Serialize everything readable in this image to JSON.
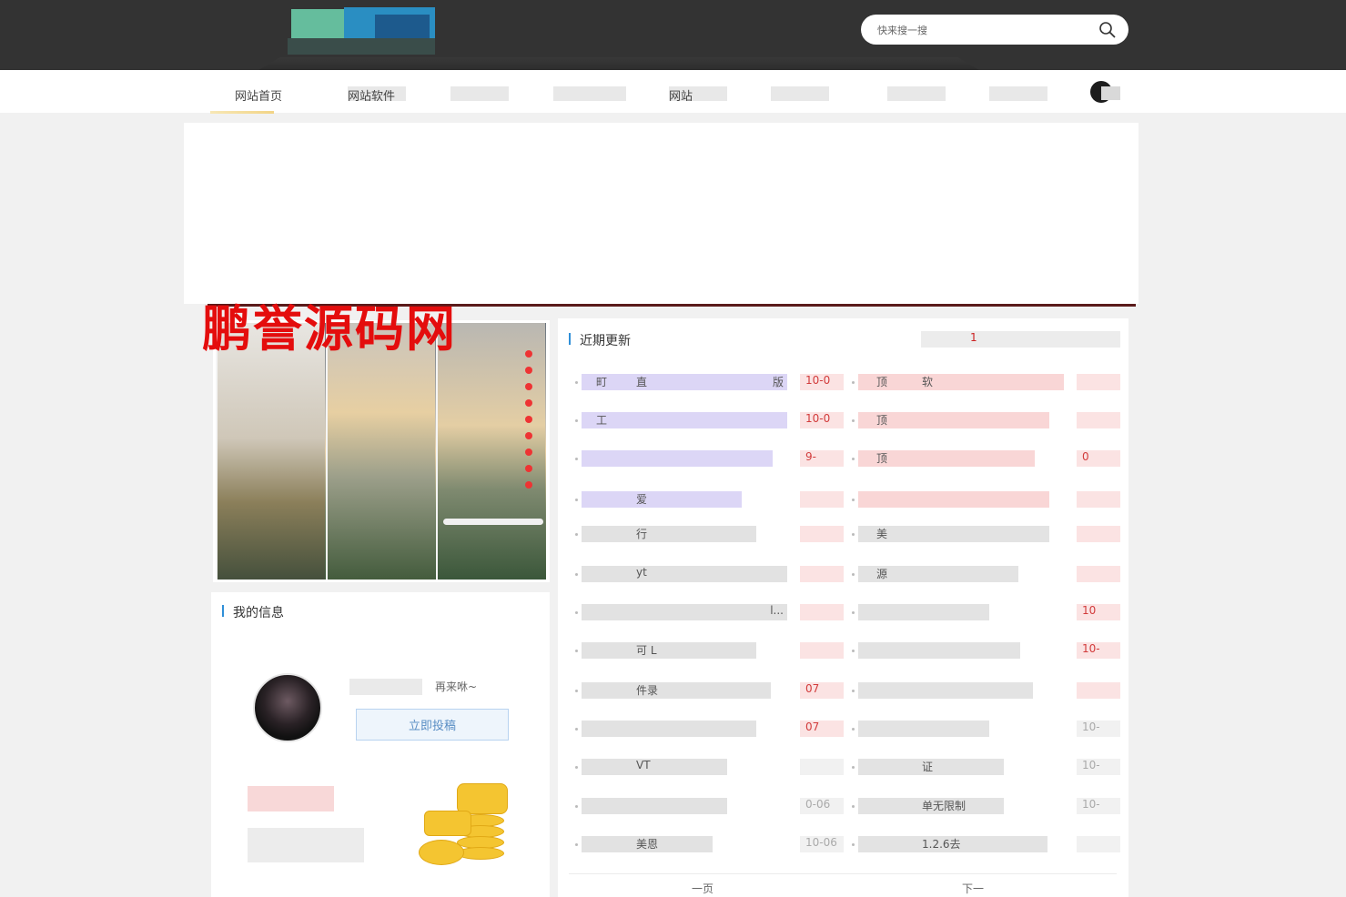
{
  "header": {
    "search": {
      "placeholder": "快来搜一搜",
      "value": ""
    }
  },
  "nav": {
    "items": [
      {
        "label": "网站首页"
      },
      {
        "label": "网站软件"
      },
      {
        "label": ""
      },
      {
        "label": ""
      },
      {
        "label": "网站"
      },
      {
        "label": ""
      },
      {
        "label": ""
      },
      {
        "label": ""
      }
    ]
  },
  "watermark": {
    "text": "鹏誉源码网"
  },
  "info_card": {
    "title": "我的信息",
    "greeting": "再来咻~",
    "submit_button": "立即投稿"
  },
  "list": {
    "title": "近期更新",
    "hot_tab": "1",
    "rows": [
      {
        "left": "町",
        "left_mid": "直",
        "left_end": "版",
        "left_date": "10-0",
        "right": "顶",
        "right_mid": "软",
        "right_date": ""
      },
      {
        "left": "工",
        "left_mid": "",
        "left_end": "",
        "left_date": "10-0",
        "right": "顶",
        "right_mid": "",
        "right_date": ""
      },
      {
        "left": "",
        "left_mid": "",
        "left_end": "",
        "left_date": "9-",
        "right": "顶",
        "right_mid": "",
        "right_date": "0"
      },
      {
        "left": "",
        "left_mid": "爱",
        "left_end": "",
        "left_date": "",
        "right": "",
        "right_mid": "",
        "right_date": ""
      },
      {
        "left": "",
        "left_mid": "行",
        "left_end": "",
        "left_date": "",
        "right": "美",
        "right_mid": "",
        "right_date": ""
      },
      {
        "left": "",
        "left_mid": "yt",
        "left_end": "",
        "left_date": "",
        "right": "源",
        "right_mid": "",
        "right_date": ""
      },
      {
        "left": "",
        "left_mid": "",
        "left_end": "l...",
        "left_date": "",
        "right": "",
        "right_mid": "",
        "right_date": "10"
      },
      {
        "left": "",
        "left_mid": "可 L",
        "left_end": "",
        "left_date": "",
        "right": "",
        "right_mid": "",
        "right_date": "10-"
      },
      {
        "left": "",
        "left_mid": "件录",
        "left_end": "",
        "left_date": "07",
        "right": "",
        "right_mid": "",
        "right_date": ""
      },
      {
        "left": "",
        "left_mid": "",
        "left_end": "",
        "left_date": "07",
        "right": "",
        "right_mid": "",
        "right_date": "10-"
      },
      {
        "left": "",
        "left_mid": "VT",
        "left_end": "",
        "left_date": "",
        "right": "",
        "right_mid": "证",
        "right_date": "10-"
      },
      {
        "left": "",
        "left_mid": "",
        "left_end": "",
        "left_date": "0-06",
        "right": "",
        "right_mid": "单无限制",
        "right_date": "10-"
      },
      {
        "left": "",
        "left_mid": "美恩",
        "left_end": "",
        "left_date": "10-06",
        "right": "",
        "right_mid": "1.2.6去",
        "right_date": ""
      }
    ],
    "pager": {
      "prev": "一页",
      "next": "下一"
    }
  }
}
